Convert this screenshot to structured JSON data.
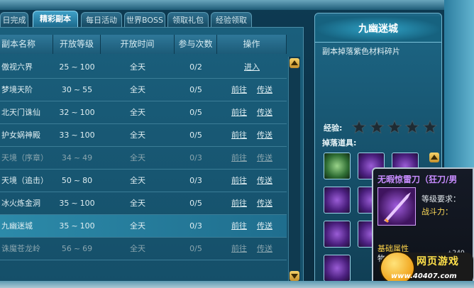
{
  "tabs": [
    {
      "label": "日完成"
    },
    {
      "label": "精彩副本",
      "active": true
    },
    {
      "label": "每日活动"
    },
    {
      "label": "世界BOSS"
    },
    {
      "label": "领取礼包"
    },
    {
      "label": "经验领取"
    }
  ],
  "table": {
    "headers": [
      "副本名称",
      "开放等级",
      "开放时间",
      "参与次数",
      "操作"
    ],
    "rows": [
      {
        "name": "傲视六界",
        "level_min": "25",
        "level_max": "100",
        "time": "全天",
        "count": "0/2",
        "action1": "进入",
        "action2": "",
        "dim": false
      },
      {
        "name": "梦境天阶",
        "level_min": "30",
        "level_max": "55",
        "time": "全天",
        "count": "0/5",
        "action1": "前往",
        "action2": "传送",
        "dim": false
      },
      {
        "name": "北天门诛仙",
        "level_min": "32",
        "level_max": "100",
        "time": "全天",
        "count": "0/5",
        "action1": "前往",
        "action2": "传送",
        "dim": false
      },
      {
        "name": "护女娲神殿",
        "level_min": "33",
        "level_max": "100",
        "time": "全天",
        "count": "0/5",
        "action1": "前往",
        "action2": "传送",
        "dim": false
      },
      {
        "name": "天境（序章）",
        "level_min": "34",
        "level_max": "49",
        "time": "全天",
        "count": "0/3",
        "action1": "前往",
        "action2": "传送",
        "dim": true
      },
      {
        "name": "天境（追击）",
        "level_min": "50",
        "level_max": "80",
        "time": "全天",
        "count": "0/3",
        "action1": "前往",
        "action2": "传送",
        "dim": false
      },
      {
        "name": "冰火炼金洞",
        "level_min": "35",
        "level_max": "100",
        "time": "全天",
        "count": "0/5",
        "action1": "前往",
        "action2": "传送",
        "dim": false
      },
      {
        "name": "九幽迷城",
        "level_min": "35",
        "level_max": "100",
        "time": "全天",
        "count": "0/3",
        "action1": "前往",
        "action2": "传送",
        "dim": false,
        "selected": true
      },
      {
        "name": "诛魔苍龙岭",
        "level_min": "56",
        "level_max": "69",
        "time": "全天",
        "count": "0/5",
        "action1": "前往",
        "action2": "传送",
        "dim": true
      }
    ],
    "range_sep": "~"
  },
  "detail": {
    "title": "九幽迷城",
    "description": "副本掉落紫色材料碎片",
    "exp_label": "经验:",
    "stars": 5,
    "drops_label": "掉落道具:"
  },
  "tooltip": {
    "title": "无暇惊雷刀（狂刀/男",
    "req_label": "等级要求：",
    "power_label": "战斗力：",
    "base_label": "基础属性",
    "base_line": "物",
    "plus": "+240"
  },
  "logo": {
    "text_cn": "网页游戏",
    "url": "www.40407.com"
  },
  "colors": {
    "accent": "#3fa0c7",
    "star": "#1e2b33",
    "tooltip_title": "#c88cff",
    "logo_gold": "#ffe14a"
  }
}
